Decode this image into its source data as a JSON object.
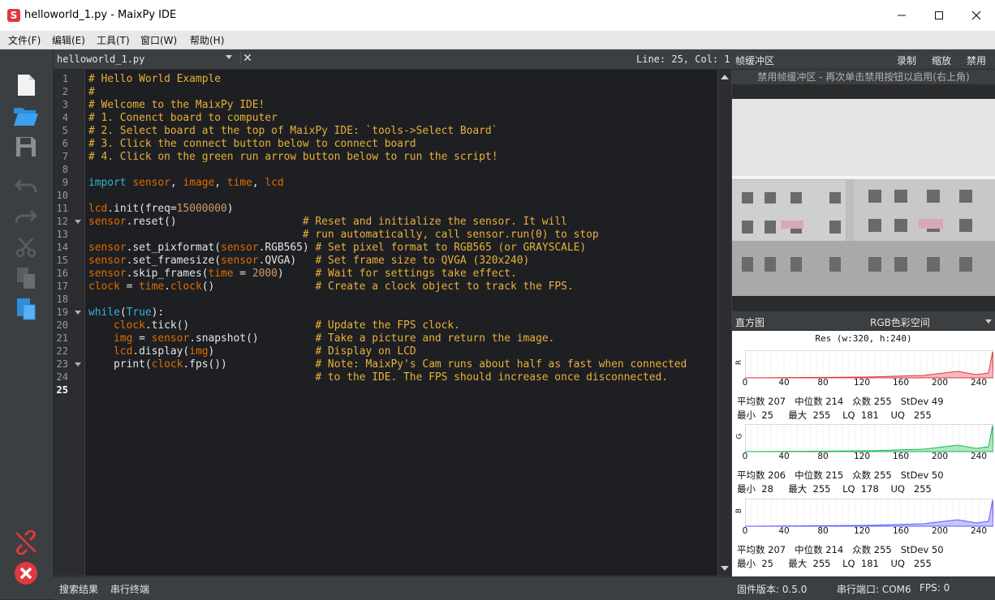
{
  "window": {
    "title": "helloworld_1.py - MaixPy IDE",
    "logo": "S",
    "minimize_icon": "minimize-icon",
    "maximize_icon": "maximize-icon",
    "close_icon": "close-icon"
  },
  "menu": {
    "items": [
      "文件(F)",
      "编辑(E)",
      "工具(T)",
      "窗口(W)",
      "帮助(H)"
    ]
  },
  "editor": {
    "tab_name": "helloworld_1.py",
    "cursor": "Line: 25, Col: 1",
    "code_lines": [
      {
        "n": "1",
        "t": "# Hello World Example"
      },
      {
        "n": "2",
        "t": "#"
      },
      {
        "n": "3",
        "t": "# Welcome to the MaixPy IDE!"
      },
      {
        "n": "4",
        "t": "# 1. Conenct board to computer"
      },
      {
        "n": "5",
        "t": "# 2. Select board at the top of MaixPy IDE: `tools->Select Board`"
      },
      {
        "n": "6",
        "t": "# 3. Click the connect button below to connect board"
      },
      {
        "n": "7",
        "t": "# 4. Click on the green run arrow button below to run the script!"
      },
      {
        "n": "8",
        "t": ""
      },
      {
        "n": "9",
        "t": "import sensor, image, time, lcd"
      },
      {
        "n": "10",
        "t": ""
      },
      {
        "n": "11",
        "t": "lcd.init(freq=15000000)"
      },
      {
        "n": "12",
        "t": "sensor.reset()                    # Reset and initialize the sensor. It will"
      },
      {
        "n": "13",
        "t": "                                  # run automatically, call sensor.run(0) to stop"
      },
      {
        "n": "14",
        "t": "sensor.set_pixformat(sensor.RGB565) # Set pixel format to RGB565 (or GRAYSCALE)"
      },
      {
        "n": "15",
        "t": "sensor.set_framesize(sensor.QVGA)   # Set frame size to QVGA (320x240)"
      },
      {
        "n": "16",
        "t": "sensor.skip_frames(time = 2000)     # Wait for settings take effect."
      },
      {
        "n": "17",
        "t": "clock = time.clock()                # Create a clock object to track the FPS."
      },
      {
        "n": "18",
        "t": ""
      },
      {
        "n": "19",
        "t": "while(True):"
      },
      {
        "n": "20",
        "t": "    clock.tick()                    # Update the FPS clock."
      },
      {
        "n": "21",
        "t": "    img = sensor.snapshot()         # Take a picture and return the image."
      },
      {
        "n": "22",
        "t": "    lcd.display(img)                # Display on LCD"
      },
      {
        "n": "23",
        "t": "    print(clock.fps())              # Note: MaixPy's Cam runs about half as fast when connected"
      },
      {
        "n": "24",
        "t": "                                    # to the IDE. The FPS should increase once disconnected."
      },
      {
        "n": "25",
        "t": ""
      }
    ]
  },
  "frame_buffer": {
    "title": "帧缓冲区",
    "record": "录制",
    "zoom": "缩放",
    "disable": "禁用",
    "message": "禁用帧缓冲区 - 再次单击禁用按钮以启用(右上角)"
  },
  "histogram": {
    "title": "直方图",
    "color_space": "RGB色彩空间",
    "resolution": "Res (w:320, h:240)",
    "ticks": [
      "0",
      "40",
      "80",
      "120",
      "160",
      "200",
      "240"
    ],
    "channels": [
      {
        "label": "R",
        "color": "#e0383e",
        "row1": "平均数 207   中位数 214   众数 255   StDev 49",
        "row2": "最小  25     最大  255    LQ  181    UQ   255"
      },
      {
        "label": "G",
        "color": "#1db954",
        "row1": "平均数 206   中位数 215   众数 255   StDev 50",
        "row2": "最小  28     最大  255    LQ  178    UQ   255"
      },
      {
        "label": "B",
        "color": "#5b5bff",
        "row1": "平均数 207   中位数 214   众数 255   StDev 50",
        "row2": "最小  25     最大  255    LQ  181    UQ   255"
      }
    ]
  },
  "status": {
    "search_results": "搜索结果",
    "serial_terminal": "串行终端",
    "firmware": "固件版本: 0.5.0",
    "serial_port": "串行端口: COM6",
    "fps": "FPS: 0"
  }
}
